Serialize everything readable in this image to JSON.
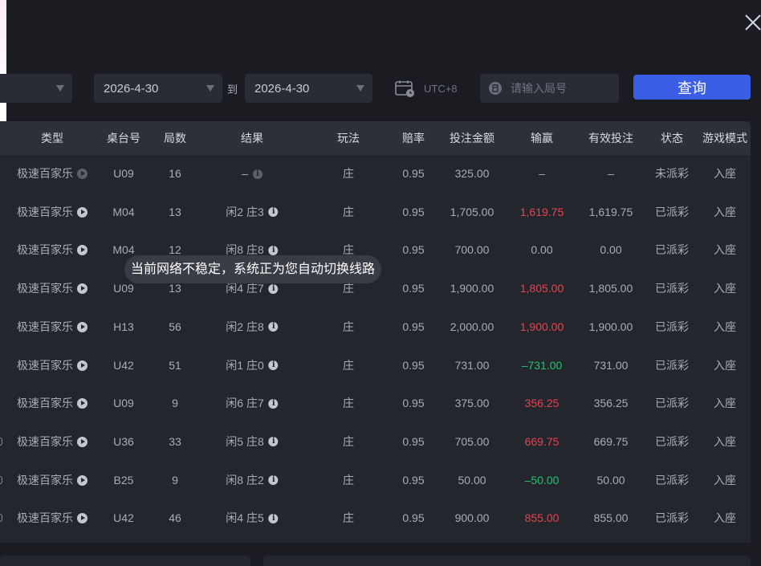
{
  "filters": {
    "start_date": "2026-4-30",
    "to_label": "到",
    "end_date": "2026-4-30",
    "timezone": "UTC+8",
    "round_placeholder": "请输入局号",
    "query_label": "查询"
  },
  "table": {
    "headers": {
      "type": "类型",
      "table_no": "桌台号",
      "rounds": "局数",
      "result": "结果",
      "play": "玩法",
      "odds": "赔率",
      "bet": "投注金额",
      "win_loss": "输赢",
      "valid_bet": "有效投注",
      "status": "状态",
      "mode": "游戏模式"
    },
    "rows": [
      {
        "type": "极速百家乐",
        "table_no": "U09",
        "rounds": "16",
        "result": "–",
        "play": "庄",
        "odds": "0.95",
        "bet": "325.00",
        "win_loss": "–",
        "valid_bet": "–",
        "status": "未派彩",
        "mode": "入座"
      },
      {
        "type": "极速百家乐",
        "table_no": "M04",
        "rounds": "13",
        "result": "闲2 庄3",
        "play": "庄",
        "odds": "0.95",
        "bet": "1,705.00",
        "win_loss": "1,619.75",
        "valid_bet": "1,619.75",
        "status": "已派彩",
        "mode": "入座"
      },
      {
        "type": "极速百家乐",
        "table_no": "M04",
        "rounds": "12",
        "result": "闲8 庄8",
        "play": "庄",
        "odds": "0.95",
        "bet": "700.00",
        "win_loss": "0.00",
        "valid_bet": "0.00",
        "status": "已派彩",
        "mode": "入座"
      },
      {
        "type": "极速百家乐",
        "table_no": "U09",
        "rounds": "13",
        "result": "闲4 庄7",
        "play": "庄",
        "odds": "0.95",
        "bet": "1,900.00",
        "win_loss": "1,805.00",
        "valid_bet": "1,805.00",
        "status": "已派彩",
        "mode": "入座"
      },
      {
        "type": "极速百家乐",
        "table_no": "H13",
        "rounds": "56",
        "result": "闲2 庄8",
        "play": "庄",
        "odds": "0.95",
        "bet": "2,000.00",
        "win_loss": "1,900.00",
        "valid_bet": "1,900.00",
        "status": "已派彩",
        "mode": "入座"
      },
      {
        "type": "极速百家乐",
        "table_no": "U42",
        "rounds": "51",
        "result": "闲1 庄0",
        "play": "庄",
        "odds": "0.95",
        "bet": "731.00",
        "win_loss": "–731.00",
        "valid_bet": "731.00",
        "status": "已派彩",
        "mode": "入座"
      },
      {
        "type": "极速百家乐",
        "table_no": "U09",
        "rounds": "9",
        "result": "闲6 庄7",
        "play": "庄",
        "odds": "0.95",
        "bet": "375.00",
        "win_loss": "356.25",
        "valid_bet": "356.25",
        "status": "已派彩",
        "mode": "入座"
      },
      {
        "type": "极速百家乐",
        "table_no": "U36",
        "rounds": "33",
        "result": "闲5 庄8",
        "play": "庄",
        "odds": "0.95",
        "bet": "705.00",
        "win_loss": "669.75",
        "valid_bet": "669.75",
        "status": "已派彩",
        "mode": "入座"
      },
      {
        "type": "极速百家乐",
        "table_no": "B25",
        "rounds": "9",
        "result": "闲8 庄2",
        "play": "庄",
        "odds": "0.95",
        "bet": "50.00",
        "win_loss": "–50.00",
        "valid_bet": "50.00",
        "status": "已派彩",
        "mode": "入座"
      },
      {
        "type": "极速百家乐",
        "table_no": "U42",
        "rounds": "46",
        "result": "闲4 庄5",
        "play": "庄",
        "odds": "0.95",
        "bet": "900.00",
        "win_loss": "855.00",
        "valid_bet": "855.00",
        "status": "已派彩",
        "mode": "入座"
      }
    ],
    "win_loss_colors": [
      "neutral",
      "red",
      "neutral",
      "red",
      "red",
      "green",
      "red",
      "red",
      "green",
      "red"
    ]
  },
  "toast": {
    "message": "当前网络不稳定，系统正为您自动切换线路"
  },
  "colors": {
    "background": "#1b1c21",
    "table_bg": "#24262e",
    "header_bg": "#2d2f39",
    "accent_blue": "#3b5ee6",
    "win_red": "#e8424d",
    "loss_green": "#23c26b"
  },
  "icons": {
    "close": "close-icon",
    "timezone": "calendar-clock-icon",
    "round": "round-id-icon",
    "play": "play-circle-icon",
    "info": "info-icon"
  }
}
